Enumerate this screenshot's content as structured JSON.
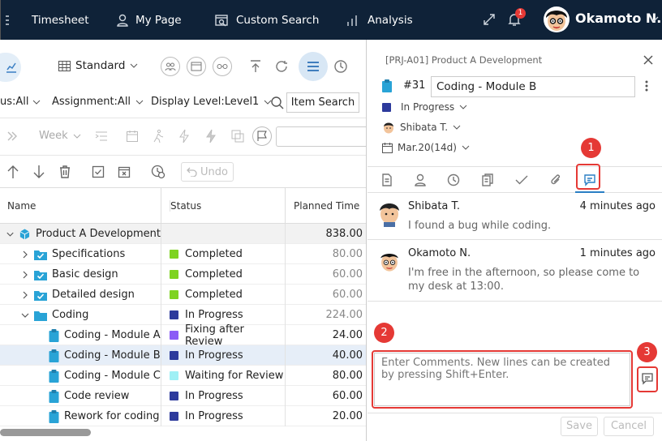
{
  "topbar": {
    "nav": [
      "Timesheet",
      "My Page",
      "Custom Search",
      "Analysis"
    ],
    "notification_count": "1",
    "user_name": "Okamoto N."
  },
  "toolbar": {
    "view": "Standard",
    "filters": [
      "us:All",
      "Assignment:All",
      "Display Level:Level1"
    ],
    "item_search": "Item Search",
    "period": "Week",
    "undo": "Undo"
  },
  "grid": {
    "columns": [
      "Name",
      "Status",
      "Planned Time"
    ],
    "rows": [
      {
        "name": "Product A Development",
        "status": "",
        "time": "838.00"
      },
      {
        "name": "Specifications",
        "status": "Completed",
        "time": "80.00"
      },
      {
        "name": "Basic design",
        "status": "Completed",
        "time": "60.00"
      },
      {
        "name": "Detailed design",
        "status": "Completed",
        "time": "60.00"
      },
      {
        "name": "Coding",
        "status": "In Progress",
        "time": "224.00"
      },
      {
        "name": "Coding - Module A",
        "status": "Fixing after Review",
        "time": "24.00"
      },
      {
        "name": "Coding - Module B",
        "status": "In Progress",
        "time": "40.00"
      },
      {
        "name": "Coding - Module C",
        "status": "Waiting for Review",
        "time": "80.00"
      },
      {
        "name": "Code review",
        "status": "In Progress",
        "time": "60.00"
      },
      {
        "name": "Rework for coding",
        "status": "In Progress",
        "time": "20.00"
      }
    ]
  },
  "status_colors": {
    "Completed": "#7ed321",
    "In Progress": "#2d3a9c",
    "Fixing after Review": "#8b5cf6",
    "Waiting for Review": "#9ff0f5"
  },
  "panel": {
    "project": "[PRJ-A01] Product A Development",
    "task_no": "#31",
    "task_title": "Coding - Module B",
    "status": "In Progress",
    "assignee": "Shibata T.",
    "date": "Mar.20(14d)",
    "comments": [
      {
        "author": "Shibata T.",
        "time": "4 minutes ago",
        "text": "I found a bug while coding."
      },
      {
        "author": "Okamoto N.",
        "time": "1 minutes ago",
        "text": "I'm free in the afternoon, so please come to my desk at 13:00."
      }
    ],
    "comment_placeholder": "Enter Comments. New lines can be created by pressing Shift+Enter.",
    "save": "Save",
    "cancel": "Cancel"
  },
  "markers": [
    "1",
    "2",
    "3"
  ]
}
